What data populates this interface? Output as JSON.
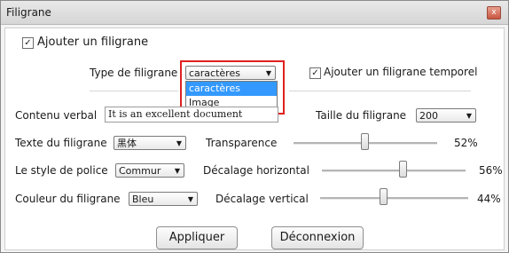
{
  "window": {
    "title": "Filigrane",
    "close_glyph": "x"
  },
  "add_watermark": {
    "label": "Ajouter un filigrane",
    "checked": true
  },
  "type": {
    "label": "Type de filigrane",
    "selected": "caractères",
    "options": [
      "caractères",
      "Image"
    ],
    "highlighted_option": "caractères"
  },
  "temporal": {
    "label": "Ajouter un filigrane temporel",
    "checked": true
  },
  "content": {
    "label": "Contenu verbal",
    "value": "It is an excellent document comme"
  },
  "size": {
    "label": "Taille du filigrane",
    "value": "200"
  },
  "font": {
    "label": "Texte du filigrane",
    "value": "黑体"
  },
  "transparency": {
    "label": "Transparence",
    "percent_text": "52%",
    "value": 52
  },
  "style": {
    "label": "Le style de police",
    "value": "Commur"
  },
  "hoffset": {
    "label": "Décalage horizontal",
    "percent_text": "56%",
    "value": 56
  },
  "color": {
    "label": "Couleur du filigrane",
    "value": "Bleu"
  },
  "voffset": {
    "label": "Décalage vertical",
    "percent_text": "44%",
    "value": 44
  },
  "buttons": {
    "apply": "Appliquer",
    "disconnect": "Déconnexion"
  },
  "icons": {
    "dropdown_arrow": "▼",
    "check": "✓"
  },
  "colors": {
    "highlight": "#3399ff",
    "annotation_box": "#e02020"
  }
}
